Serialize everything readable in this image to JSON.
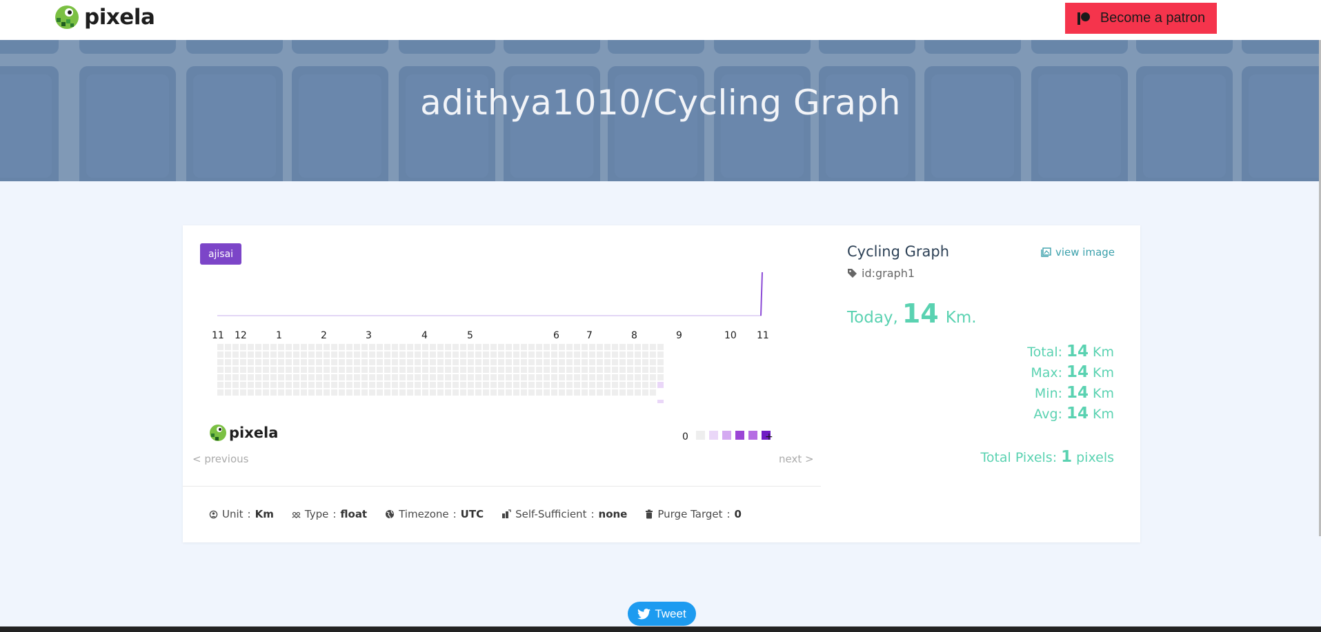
{
  "header": {
    "brand": "pixela",
    "patron_label": "Become a patron"
  },
  "hero": {
    "title": "adithya1010/Cycling Graph"
  },
  "graph": {
    "theme": "ajisai",
    "month_labels": [
      "11",
      "12",
      "1",
      "2",
      "3",
      "4",
      "5",
      "6",
      "7",
      "8",
      "9",
      "10",
      "11"
    ],
    "legend_zero": "0",
    "legend_plus": "+",
    "logo_text": "pixela",
    "prev_label": "< previous",
    "next_label": "next >",
    "colors": {
      "empty": "#eeeeee",
      "level1": "#ead7f8",
      "level2": "#d4a9f1",
      "level3": "#b56de3",
      "level4": "#9b45d6",
      "level5": "#6f1dc5",
      "line": "#e3d6f5",
      "accent": "#7c45c8"
    }
  },
  "attributes": [
    {
      "key": "Unit",
      "value": "Km",
      "icon": "unit-icon"
    },
    {
      "key": "Type",
      "value": "float",
      "icon": "type-icon"
    },
    {
      "key": "Timezone",
      "value": "UTC",
      "icon": "globe-icon"
    },
    {
      "key": "Self-Sufficient",
      "value": "none",
      "icon": "self-sufficient-icon"
    },
    {
      "key": "Purge Target",
      "value": "0",
      "icon": "trash-icon"
    }
  ],
  "info": {
    "title": "Cycling Graph",
    "view_image": "view image",
    "id_label": "id:graph1",
    "today_label": "Today",
    "today_value": "14",
    "today_unit": "Km.",
    "stats": [
      {
        "label": "Total:",
        "value": "14",
        "unit": "Km"
      },
      {
        "label": "Max:",
        "value": "14",
        "unit": "Km"
      },
      {
        "label": "Min:",
        "value": "14",
        "unit": "Km"
      },
      {
        "label": "Avg:",
        "value": "14",
        "unit": "Km"
      }
    ],
    "total_pixels_label": "Total Pixels:",
    "total_pixels_value": "1",
    "total_pixels_unit": "pixels"
  },
  "tweet": {
    "label": "Tweet"
  }
}
